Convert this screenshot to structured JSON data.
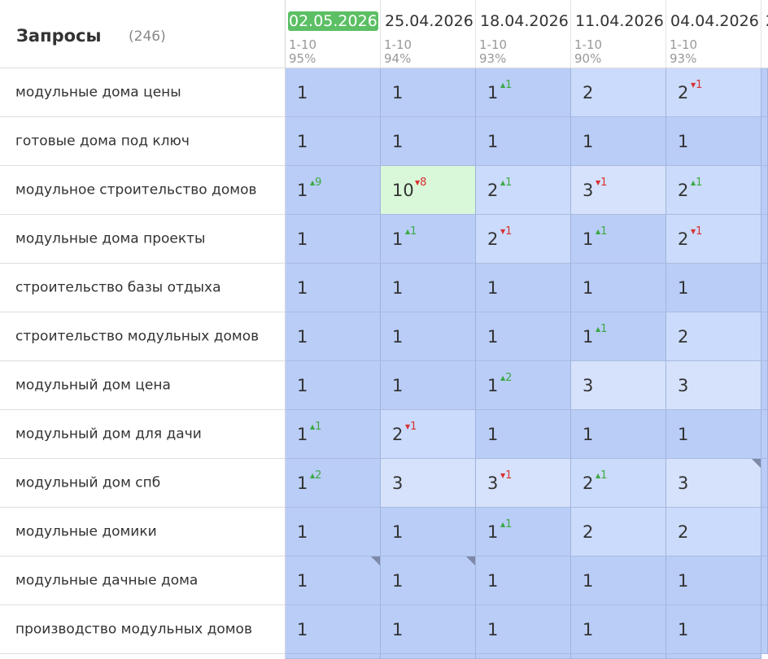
{
  "header": {
    "title": "Запросы",
    "count": "(246)"
  },
  "dates": [
    {
      "date": "02.05.2026",
      "range": "1-10",
      "pct": "95%",
      "current": true
    },
    {
      "date": "25.04.2026",
      "range": "1-10",
      "pct": "94%"
    },
    {
      "date": "18.04.2026",
      "range": "1-10",
      "pct": "93%"
    },
    {
      "date": "11.04.2026",
      "range": "1-10",
      "pct": "90%"
    },
    {
      "date": "04.04.2026",
      "range": "1-10",
      "pct": "93%"
    },
    {
      "date": "2"
    }
  ],
  "rows": [
    {
      "query": "модульные дома цены",
      "cells": [
        {
          "v": "1"
        },
        {
          "v": "1"
        },
        {
          "v": "1",
          "d": "1",
          "dir": "up"
        },
        {
          "v": "2"
        },
        {
          "v": "2",
          "d": "1",
          "dir": "down"
        }
      ]
    },
    {
      "query": "готовые дома под ключ",
      "cells": [
        {
          "v": "1"
        },
        {
          "v": "1"
        },
        {
          "v": "1"
        },
        {
          "v": "1"
        },
        {
          "v": "1"
        }
      ]
    },
    {
      "query": "модульное строительство домов",
      "cells": [
        {
          "v": "1",
          "d": "9",
          "dir": "up"
        },
        {
          "v": "10",
          "d": "8",
          "dir": "down"
        },
        {
          "v": "2",
          "d": "1",
          "dir": "up"
        },
        {
          "v": "3",
          "d": "1",
          "dir": "down"
        },
        {
          "v": "2",
          "d": "1",
          "dir": "up"
        }
      ]
    },
    {
      "query": "модульные дома проекты",
      "cells": [
        {
          "v": "1"
        },
        {
          "v": "1",
          "d": "1",
          "dir": "up"
        },
        {
          "v": "2",
          "d": "1",
          "dir": "down"
        },
        {
          "v": "1",
          "d": "1",
          "dir": "up"
        },
        {
          "v": "2",
          "d": "1",
          "dir": "down"
        }
      ]
    },
    {
      "query": "строительство базы отдыха",
      "cells": [
        {
          "v": "1"
        },
        {
          "v": "1"
        },
        {
          "v": "1"
        },
        {
          "v": "1"
        },
        {
          "v": "1"
        }
      ]
    },
    {
      "query": "строительство модульных домов",
      "cells": [
        {
          "v": "1"
        },
        {
          "v": "1"
        },
        {
          "v": "1"
        },
        {
          "v": "1",
          "d": "1",
          "dir": "up"
        },
        {
          "v": "2"
        }
      ]
    },
    {
      "query": "модульный дом цена",
      "cells": [
        {
          "v": "1"
        },
        {
          "v": "1"
        },
        {
          "v": "1",
          "d": "2",
          "dir": "up"
        },
        {
          "v": "3"
        },
        {
          "v": "3"
        }
      ]
    },
    {
      "query": "модульный дом для дачи",
      "cells": [
        {
          "v": "1",
          "d": "1",
          "dir": "up"
        },
        {
          "v": "2",
          "d": "1",
          "dir": "down"
        },
        {
          "v": "1"
        },
        {
          "v": "1"
        },
        {
          "v": "1"
        }
      ]
    },
    {
      "query": "модульный дом спб",
      "cells": [
        {
          "v": "1",
          "d": "2",
          "dir": "up"
        },
        {
          "v": "3"
        },
        {
          "v": "3",
          "d": "1",
          "dir": "down"
        },
        {
          "v": "2",
          "d": "1",
          "dir": "up"
        },
        {
          "v": "3"
        }
      ]
    },
    {
      "query": "модульные домики",
      "cells": [
        {
          "v": "1"
        },
        {
          "v": "1"
        },
        {
          "v": "1",
          "d": "1",
          "dir": "up"
        },
        {
          "v": "2"
        },
        {
          "v": "2"
        }
      ]
    },
    {
      "query": "модульные дачные дома",
      "cells": [
        {
          "v": "1"
        },
        {
          "v": "1"
        },
        {
          "v": "1"
        },
        {
          "v": "1"
        },
        {
          "v": "1"
        }
      ]
    },
    {
      "query": "производство модульных домов",
      "cells": [
        {
          "v": "1"
        },
        {
          "v": "1"
        },
        {
          "v": "1"
        },
        {
          "v": "1"
        },
        {
          "v": "1"
        }
      ]
    }
  ],
  "colors": {
    "current_date_bg": "#5cbf64",
    "position_1": "#b9cdf7",
    "position_2": "#cbdbfb",
    "position_3": "#d6e2fb",
    "position_10": "#d9f8d9",
    "delta_up": "#3ca844",
    "delta_down": "#d83030"
  },
  "icons": {
    "delta_up": "triangle-up-icon",
    "delta_down": "triangle-down-icon",
    "note_marker": "corner-note-icon"
  }
}
